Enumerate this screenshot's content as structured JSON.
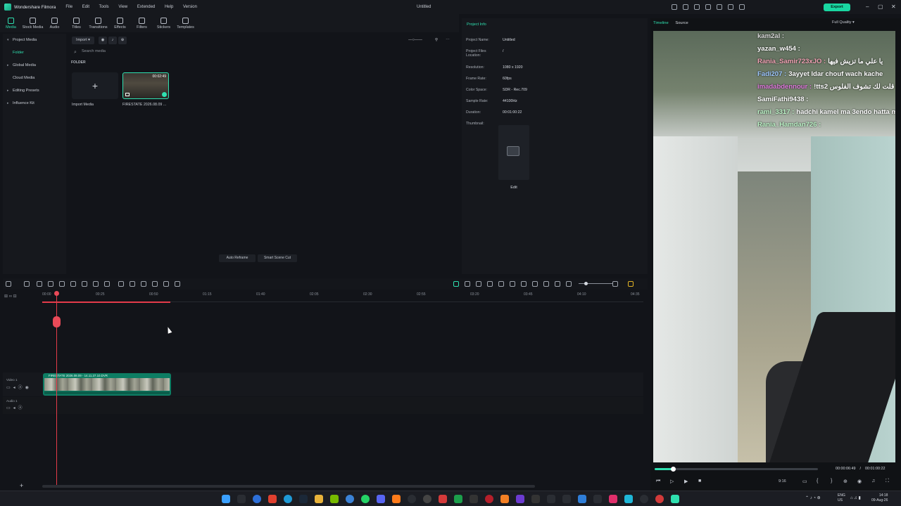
{
  "titlebar": {
    "app_name": "Wondershare Filmora",
    "menu": [
      "File",
      "Edit",
      "Tools",
      "View",
      "Extended",
      "Help",
      "Version"
    ],
    "document": "Untitled",
    "export_label": "Export"
  },
  "toolbar": {
    "tools": [
      "Media",
      "Stock Media",
      "Audio",
      "Titles",
      "Transitions",
      "Effects",
      "Filters",
      "Stickers",
      "Templates"
    ]
  },
  "sidebar": {
    "items": [
      {
        "label": "Project Media",
        "caret": "▾"
      },
      {
        "label": "Folder",
        "caret": ""
      },
      {
        "label": "Global Media",
        "caret": "▸"
      },
      {
        "label": "Cloud Media",
        "caret": ""
      },
      {
        "label": "Editing Presets",
        "caret": "▸"
      },
      {
        "label": "Influence Kit",
        "caret": "▸"
      }
    ]
  },
  "media": {
    "import_label": "Import",
    "search_placeholder": "Search media",
    "folder_heading": "FOLDER",
    "import_tile_label": "Import Media",
    "clip_duration": "00:02:49",
    "clip_name": "FIRESTATE 2026.08.09 ...",
    "auto_reframe": "Auto Reframe",
    "smart_scene_cut": "Smart Scene Cut"
  },
  "project_info": {
    "title": "Project Info",
    "rows": [
      {
        "key": "Project Name:",
        "value": "Untitled"
      },
      {
        "key": "Project Files Location:",
        "value": "/"
      },
      {
        "key": "Resolution:",
        "value": "1080 x 1920"
      },
      {
        "key": "Frame Rate:",
        "value": "60fps"
      },
      {
        "key": "Color Space:",
        "value": "SDR - Rec.709"
      },
      {
        "key": "Sample Rate:",
        "value": "44100Hz"
      },
      {
        "key": "Duration:",
        "value": "00:01:00:22"
      },
      {
        "key": "Thumbnail:",
        "value": ""
      }
    ],
    "edit_label": "Edit"
  },
  "player": {
    "tabs": [
      "Timeline",
      "Source"
    ],
    "quality": "Full Quality",
    "chat": [
      {
        "user": "kam2al :",
        "msg": "",
        "color": "#d9d9d9"
      },
      {
        "user": "yazan_w454 :",
        "msg": "",
        "color": "#ffffff"
      },
      {
        "user": "Rania_Samir723xJO :",
        "msg": "يا علي ما تزيش فيها",
        "color": "#f2a3b5"
      },
      {
        "user": "Fadi207 :",
        "msg": "3ayyet ldar chouf wach kache",
        "color": "#9ec7ff"
      },
      {
        "user": "imadabdennour :",
        "msg": "!tts2 قلت لك تشوف الفلوس",
        "color": "#e27be0"
      },
      {
        "user": "SamiFathi9438 :",
        "msg": "",
        "color": "#ffffff"
      },
      {
        "user": "rami_3317 :",
        "msg": "hadchi kamel ma 3endo hatta m",
        "color": "#bdf5c8"
      },
      {
        "user": "Rania_Hamdan726 :",
        "msg": "",
        "color": "#bdf5c8"
      }
    ],
    "current_time": "00:00:06:49",
    "separator": "/",
    "total_time": "00:01:00:22",
    "ratio": "9:16",
    "progress_fraction": 0.11
  },
  "timeline": {
    "ruler": [
      "00:00",
      "00:25",
      "00:50",
      "01:15",
      "01:40",
      "02:05",
      "02:30",
      "02:55",
      "03:20",
      "03:45",
      "04:10",
      "04:35"
    ],
    "video_track_label": "Video 1",
    "audio_track_label": "Audio 1",
    "clip_label": "FIRESTATE 2026.08.09 - 14.11.27.10.DVR"
  },
  "taskbar": {
    "lang": "ENG",
    "region": "US",
    "time": "14:18",
    "date": "09-Aug-26"
  },
  "colors": {
    "accent": "#2fe0b0",
    "playhead": "#e53b4a",
    "clip": "#0d7d63"
  }
}
